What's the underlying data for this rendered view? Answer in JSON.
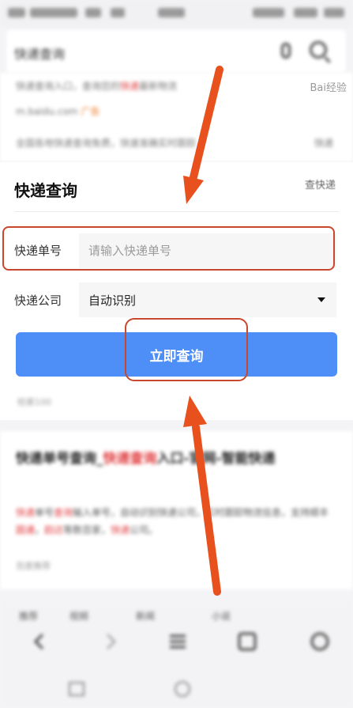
{
  "status_bar": {
    "text": ""
  },
  "search": {
    "query": "快递查询"
  },
  "top_results": {
    "line1_a": "快递查询入口，查询您的",
    "line1_red": "快递",
    "line1_b": "最新物流",
    "line2": "m.baidu.com",
    "line2_orange": "广告",
    "line3": "全国各地快递查询免费，快速准确实时跟踪",
    "line3_right": "快递"
  },
  "card": {
    "title": "快递查询",
    "source": "查快递",
    "tracking": {
      "label": "快递单号",
      "placeholder": "请输入快递单号"
    },
    "company": {
      "label": "快递公司",
      "value": "自动识别"
    },
    "query_button": "立即查询",
    "footer": "检索100"
  },
  "result2": {
    "title_a": "快递单号查询_",
    "title_red": "快递查询",
    "title_b": "入口-官网-智能快递",
    "body_red1": "快递",
    "body_a": "单号",
    "body_red2": "查询",
    "body_b": "输入单号，自动识别快递公司，实时跟踪物流信息，支持顺丰",
    "body_red3": "圆通",
    "body_c": "，",
    "body_red4": "韵达",
    "body_d": "等数百家，",
    "body_red5": "快递",
    "body_e": "公司。",
    "foot": "百度推荐"
  },
  "tabs": [
    "推荐",
    "视频",
    "新闻",
    "小说"
  ],
  "nav_icons": [
    "back-icon",
    "forward-icon",
    "menu-icon",
    "tabs-icon",
    "home-icon"
  ],
  "watermark": "Bai经验",
  "colors": {
    "primary": "#4e8ef7",
    "highlight": "#c9472c",
    "arrow": "#e8501e"
  }
}
